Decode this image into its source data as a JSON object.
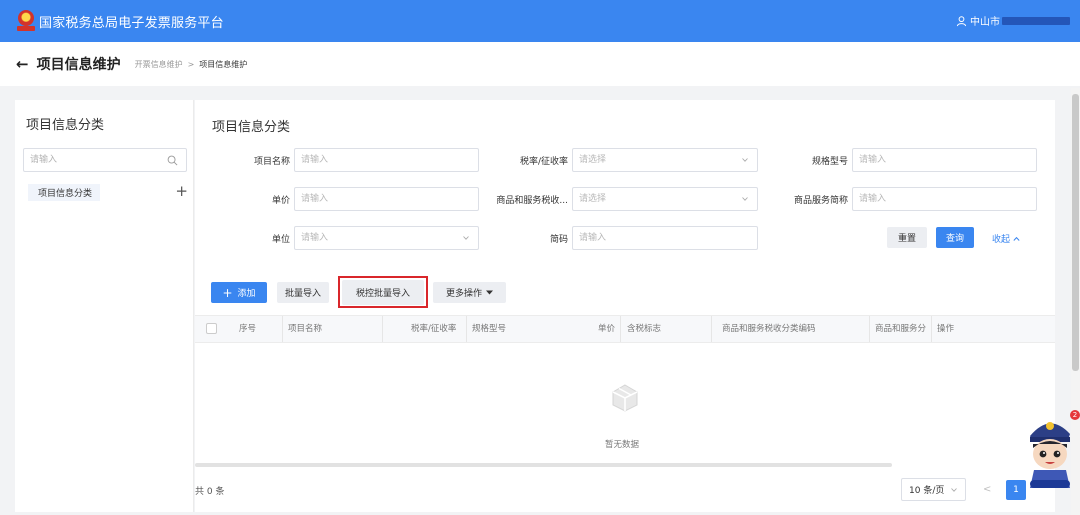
{
  "app": {
    "title": "国家税务总局电子发票服务平台",
    "user": "中山市"
  },
  "page": {
    "back_icon": "←",
    "title": "项目信息维护",
    "breadcrumb": [
      "开票信息维护",
      "项目信息维护"
    ],
    "crumb_sep": ">"
  },
  "left": {
    "title": "项目信息分类",
    "search_placeholder": "请输入",
    "tree_item": "项目信息分类",
    "add_icon": "+"
  },
  "main": {
    "title": "项目信息分类",
    "fields": {
      "item_name": {
        "label": "项目名称",
        "placeholder": "请输入"
      },
      "tax_rate": {
        "label": "税率/征收率",
        "placeholder": "请选择"
      },
      "spec": {
        "label": "规格型号",
        "placeholder": "请输入"
      },
      "unit_price": {
        "label": "单价",
        "placeholder": "请输入"
      },
      "goods_code": {
        "label": "商品和服务税收...",
        "placeholder": "请选择"
      },
      "goods_short": {
        "label": "商品服务简称",
        "placeholder": "请输入"
      },
      "unit": {
        "label": "单位",
        "placeholder": "请输入"
      },
      "shortcode": {
        "label": "简码",
        "placeholder": "请输入"
      }
    },
    "buttons": {
      "reset": "重置",
      "query": "查询",
      "collapse": "收起",
      "add": "添加",
      "add_icon": "+",
      "batch_import": "批量导入",
      "tax_batch_import": "税控批量导入",
      "more": "更多操作"
    },
    "table": {
      "columns": [
        "序号",
        "项目名称",
        "税率/征收率",
        "规格型号",
        "单价",
        "含税标志",
        "商品和服务税收分类编码",
        "商品和服务分",
        "操作"
      ],
      "empty_text": "暂无数据"
    },
    "pagination": {
      "total": "共 0 条",
      "page_size": "10 条/页",
      "prev": "<",
      "current": "1"
    }
  },
  "mascot": {
    "badge": "2"
  },
  "colors": {
    "primary": "#3a86f0",
    "highlight": "#d9262b"
  }
}
